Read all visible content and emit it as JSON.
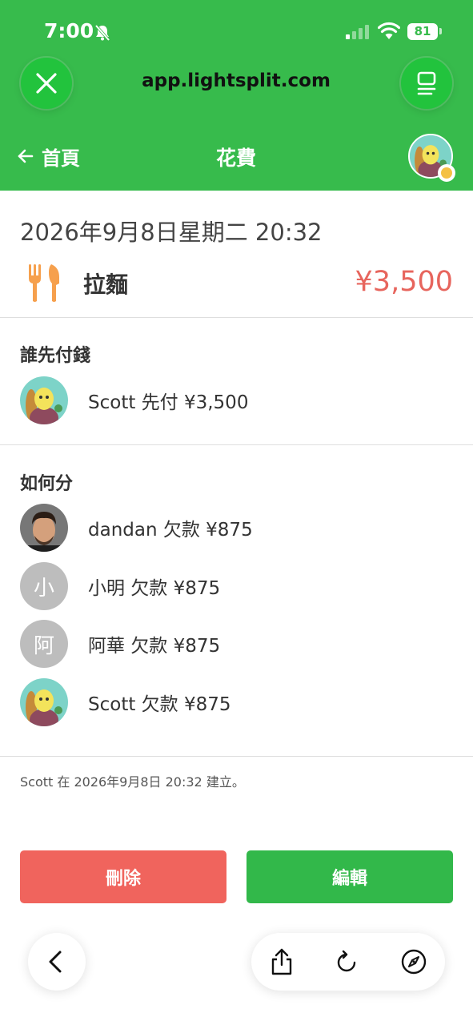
{
  "status_bar": {
    "time": "7:00",
    "battery": "81"
  },
  "browser": {
    "url": "app.lightsplit.com"
  },
  "nav": {
    "back_label": "首頁",
    "title": "花費"
  },
  "expense": {
    "datetime": "2026年9月8日星期二 20:32",
    "name": "拉麵",
    "amount": "¥3,500",
    "category_icon": "utensils-icon"
  },
  "paid_section": {
    "title": "誰先付錢",
    "payers": [
      {
        "text": "Scott 先付 ¥3,500"
      }
    ]
  },
  "split_section": {
    "title": "如何分",
    "people": [
      {
        "text": "dandan 欠款 ¥875"
      },
      {
        "initial": "小",
        "text": "小明 欠款 ¥875"
      },
      {
        "initial": "阿",
        "text": "阿華 欠款 ¥875"
      },
      {
        "text": "Scott 欠款 ¥875"
      }
    ]
  },
  "created_note": "Scott 在 2026年9月8日 20:32 建立。",
  "actions": {
    "delete_label": "刪除",
    "edit_label": "編輯"
  },
  "colors": {
    "brand_green": "#37bb4c",
    "amount_red": "#e7655d",
    "delete_red": "#f0645d",
    "edit_green": "#32b84a"
  }
}
